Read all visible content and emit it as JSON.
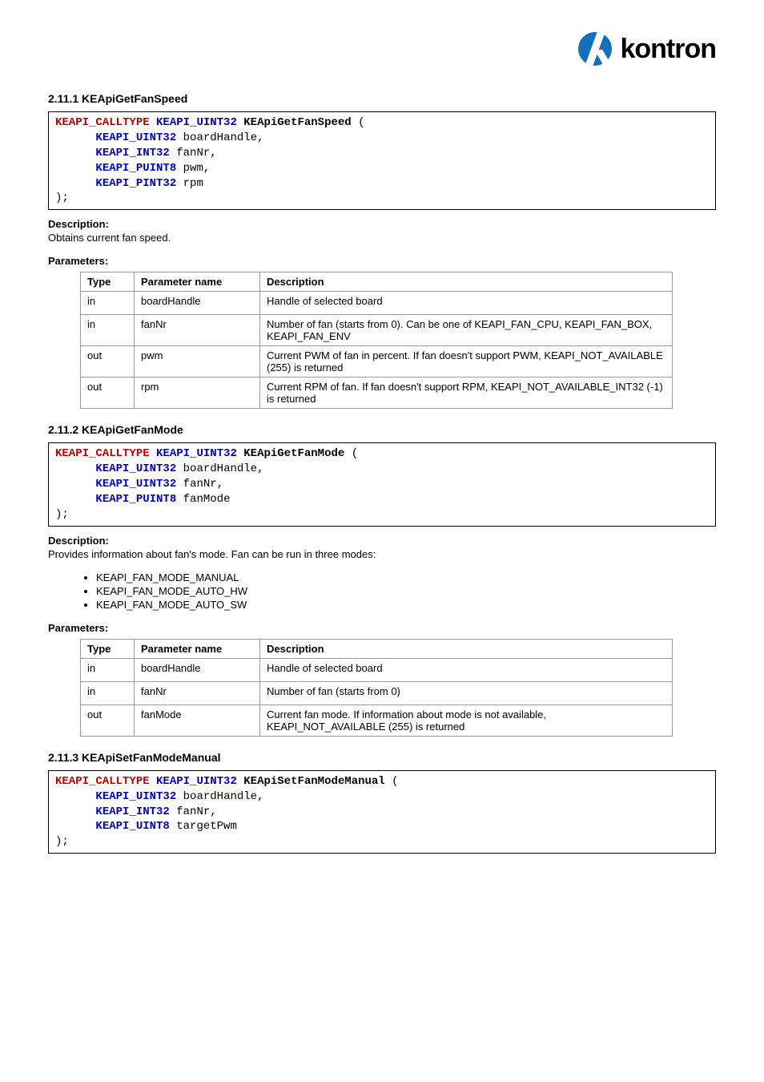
{
  "brand": "kontron",
  "sections": {
    "getFanSpeed": {
      "heading": "2.11.1 KEApiGetFanSpeed",
      "code": {
        "ret_macro": "KEAPI_CALLTYPE",
        "ret_type": "KEAPI_UINT32",
        "fn": "KEApiGetFanSpeed",
        "params": [
          {
            "type": "KEAPI_UINT32",
            "name": "boardHandle"
          },
          {
            "type": "KEAPI_INT32",
            "name": "fanNr"
          },
          {
            "type": "KEAPI_PUINT8",
            "name": "pwm"
          },
          {
            "type": "KEAPI_PINT32",
            "name": "rpm"
          }
        ],
        "tail": ");"
      },
      "desc_label": "Description:",
      "desc_text": "Obtains current fan speed.",
      "param_label": "Parameters:",
      "table": {
        "head": {
          "type": "Type",
          "name": "Parameter name",
          "desc": "Description"
        },
        "rows": [
          {
            "type": "in",
            "name": "boardHandle",
            "desc": "Handle of selected board"
          },
          {
            "type": "in",
            "name": "fanNr",
            "desc": "Number of fan (starts from 0). Can be one of KEAPI_FAN_CPU, KEAPI_FAN_BOX, KEAPI_FAN_ENV"
          },
          {
            "type": "out",
            "name": "pwm",
            "desc": "Current PWM of fan in percent. If fan doesn't support PWM, KEAPI_NOT_AVAILABLE (255) is returned"
          },
          {
            "type": "out",
            "name": "rpm",
            "desc": "Current RPM of fan. If fan doesn't support RPM, KEAPI_NOT_AVAILABLE_INT32 (-1) is returned"
          }
        ]
      }
    },
    "getFanMode": {
      "heading": "2.11.2 KEApiGetFanMode",
      "code": {
        "ret_macro": "KEAPI_CALLTYPE",
        "ret_type": "KEAPI_UINT32",
        "fn": "KEApiGetFanMode",
        "params": [
          {
            "type": "KEAPI_UINT32",
            "name": "boardHandle"
          },
          {
            "type": "KEAPI_UINT32",
            "name": "fanNr"
          },
          {
            "type": "KEAPI_PUINT8",
            "name": "fanMode"
          }
        ],
        "tail": ");"
      },
      "desc_label": "Description:",
      "desc_text": "Provides information about fan's mode. Fan can be run in three modes:",
      "modes": [
        "KEAPI_FAN_MODE_MANUAL",
        "KEAPI_FAN_MODE_AUTO_HW",
        "KEAPI_FAN_MODE_AUTO_SW"
      ],
      "param_label": "Parameters:",
      "table": {
        "head": {
          "type": "Type",
          "name": "Parameter name",
          "desc": "Description"
        },
        "rows": [
          {
            "type": "in",
            "name": "boardHandle",
            "desc": "Handle of selected board"
          },
          {
            "type": "in",
            "name": "fanNr",
            "desc": "Number of fan (starts from 0)"
          },
          {
            "type": "out",
            "name": "fanMode",
            "desc": "Current fan mode. If information about mode is not available, KEAPI_NOT_AVAILABLE (255) is returned"
          }
        ]
      }
    },
    "setFanModeManual": {
      "heading": "2.11.3 KEApiSetFanModeManual",
      "code": {
        "ret_macro": "KEAPI_CALLTYPE",
        "ret_type": "KEAPI_UINT32",
        "fn": "KEApiSetFanModeManual",
        "params": [
          {
            "type": "KEAPI_UINT32",
            "name": "boardHandle"
          },
          {
            "type": "KEAPI_INT32",
            "name": "fanNr"
          },
          {
            "type": "KEAPI_UINT8",
            "name": "targetPwm"
          }
        ],
        "tail": ");"
      }
    }
  }
}
